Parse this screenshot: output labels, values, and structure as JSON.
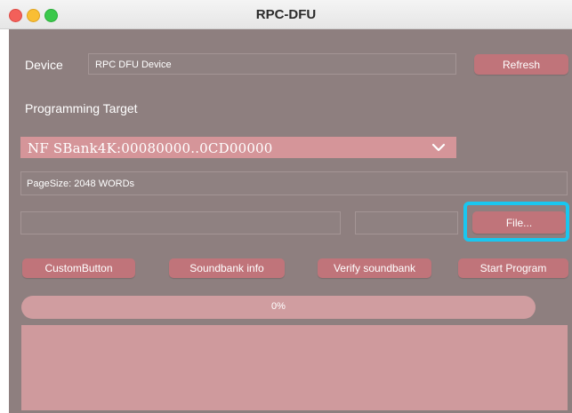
{
  "window": {
    "title": "RPC-DFU"
  },
  "device": {
    "label": "Device",
    "value": "RPC DFU Device",
    "refresh_label": "Refresh"
  },
  "programming": {
    "label": "Programming Target",
    "selected_target": "NF SBank4K:00080000..0CD00000",
    "page_size": "PageSize: 2048 WORDs"
  },
  "file": {
    "button_label": "File..."
  },
  "actions": {
    "custom_button": "CustomButton",
    "soundbank_info": "Soundbank info",
    "verify_soundbank": "Verify soundbank",
    "start_program": "Start Program"
  },
  "progress": {
    "percent_text": "0%",
    "value": 0
  },
  "log": {
    "text": ""
  }
}
